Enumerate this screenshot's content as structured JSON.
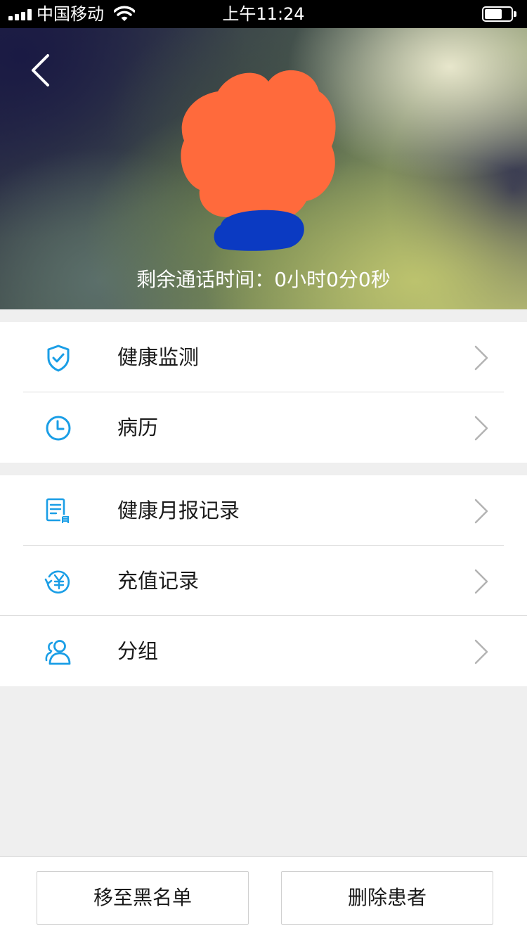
{
  "status_bar": {
    "carrier": "中国移动",
    "time": "上午11:24"
  },
  "header": {
    "remaining_label": "剩余通话时间：",
    "remaining_value": "0小时0分0秒"
  },
  "menu": {
    "group1": [
      {
        "label": "健康监测",
        "icon": "shield-check-icon"
      },
      {
        "label": "病历",
        "icon": "clock-icon"
      }
    ],
    "group2": [
      {
        "label": "健康月报记录",
        "icon": "monthly-report-icon"
      },
      {
        "label": "充值记录",
        "icon": "recharge-yen-icon"
      },
      {
        "label": "分组",
        "icon": "group-users-icon"
      }
    ]
  },
  "actions": {
    "blacklist_label": "移至黑名单",
    "delete_label": "删除患者"
  },
  "colors": {
    "accent": "#1a9ee6",
    "redaction_orange": "#ff6a3c",
    "redaction_blue": "#0b3ac2"
  }
}
